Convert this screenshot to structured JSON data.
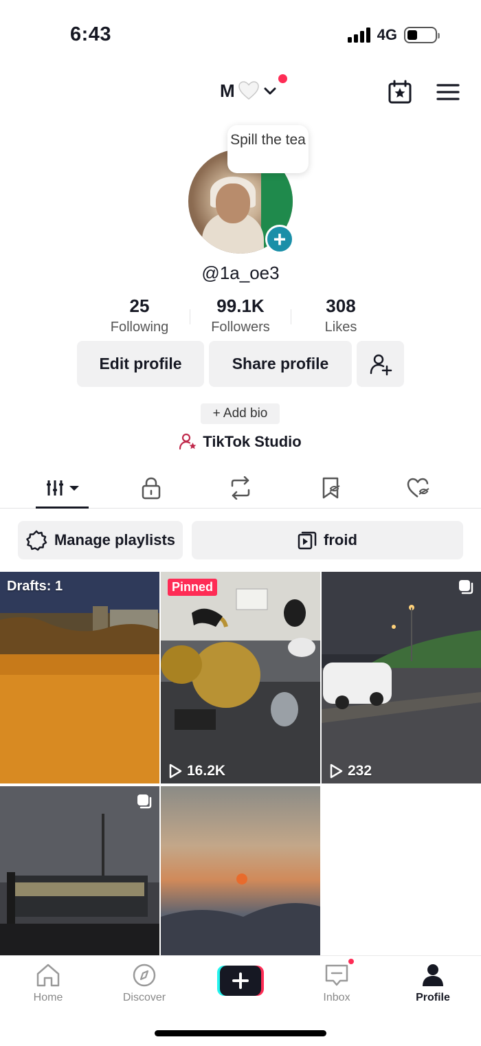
{
  "status_bar": {
    "time": "6:43",
    "network": "4G"
  },
  "header": {
    "account_name": "M"
  },
  "tooltip": {
    "text": "Spill the tea"
  },
  "profile": {
    "username": "@1a_oe3",
    "stats": [
      {
        "value": "25",
        "label": "Following"
      },
      {
        "value": "99.1K",
        "label": "Followers"
      },
      {
        "value": "308",
        "label": "Likes"
      }
    ],
    "edit_profile_label": "Edit profile",
    "share_profile_label": "Share profile",
    "add_bio_label": "+ Add bio",
    "studio_label": "TikTok Studio"
  },
  "playlists": {
    "manage_label": "Manage playlists",
    "playlist_name": "froid"
  },
  "grid": [
    {
      "overlay": "Drafts: 1"
    },
    {
      "badge": "Pinned",
      "views": "16.2K"
    },
    {
      "views": "232"
    },
    {},
    {}
  ],
  "bottom_nav": {
    "items": [
      {
        "label": "Home"
      },
      {
        "label": "Discover"
      },
      {
        "label": "Inbox"
      },
      {
        "label": "Profile"
      }
    ]
  },
  "colors": {
    "accent": "#fe2c55",
    "avatar_badge": "#1a8fa8",
    "button_bg": "#f1f1f2"
  }
}
